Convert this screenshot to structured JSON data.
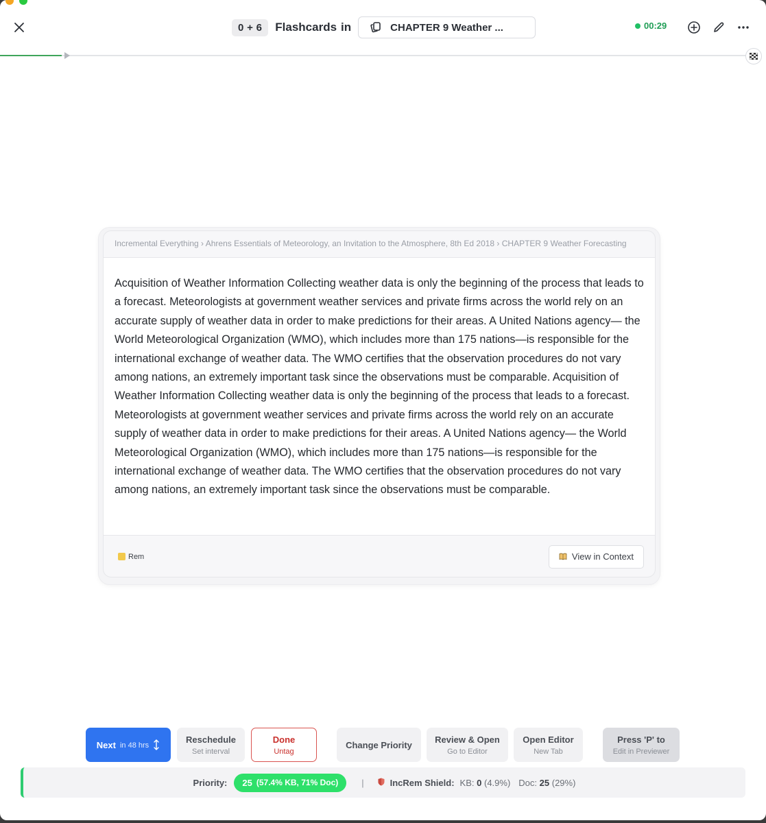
{
  "header": {
    "count_badge": "0 + 6",
    "title": "Flashcards",
    "in_word": "in",
    "document": "CHAPTER 9 Weather ...",
    "timer": "00:29"
  },
  "progress": {
    "fraction": 0.08
  },
  "card": {
    "breadcrumb": "Incremental Everything › Ahrens Essentials of Meteorology, an Invitation to the Atmosphere, 8th Ed 2018 › CHAPTER 9 Weather Forecasting",
    "text": "Acquisition of Weather Information Collecting weather data is only the beginning of the process that leads to a forecast. Meteorologists at government weather services and private firms across the world rely on an accurate supply of weather data in order to make predictions for their areas. A United Nations agency— the World Meteorological Organization (WMO), which includes more than 175 nations—is responsible for the international exchange of weather data. The WMO certifies that the observation procedures do not vary among nations, an extremely important task since the observations must be comparable. Acquisition of Weather Information Collecting weather data is only the beginning of the process that leads to a forecast. Meteorologists at government weather services and private firms across the world rely on an accurate supply of weather data in order to make predictions for their areas. A United Nations agency— the World Meteorological Organization (WMO), which includes more than 175 nations—is responsible for the international exchange of weather data. The WMO certifies that the observation procedures do not vary among nations, an extremely important task since the observations must be comparable.",
    "rem_label": "Rem",
    "view_context_label": "View in Context"
  },
  "toolbar": {
    "next": {
      "label": "Next",
      "sub": "in 48 hrs"
    },
    "reschedule": {
      "label": "Reschedule",
      "sub": "Set interval"
    },
    "done": {
      "label": "Done",
      "sub": "Untag"
    },
    "change_priority": {
      "label": "Change Priority"
    },
    "review_open": {
      "label": "Review & Open",
      "sub": "Go to Editor"
    },
    "open_editor": {
      "label": "Open Editor",
      "sub": "New Tab"
    },
    "press_p": {
      "label": "Press 'P' to",
      "sub": "Edit in Previewer"
    }
  },
  "status": {
    "priority_label": "Priority:",
    "priority_value": "25",
    "priority_detail": "(57.4% KB, 71% Doc)",
    "separator": "|",
    "shield_label": "IncRem Shield:",
    "kb_label": "KB:",
    "kb_value": "0",
    "kb_pct": "(4.9%)",
    "doc_label": "Doc:",
    "doc_value": "25",
    "doc_pct": "(29%)"
  },
  "colors": {
    "accent": "#2f74f0",
    "done_red": "#d9534f",
    "priority_green": "#2ee06a",
    "timer_green": "#1f9d55"
  }
}
